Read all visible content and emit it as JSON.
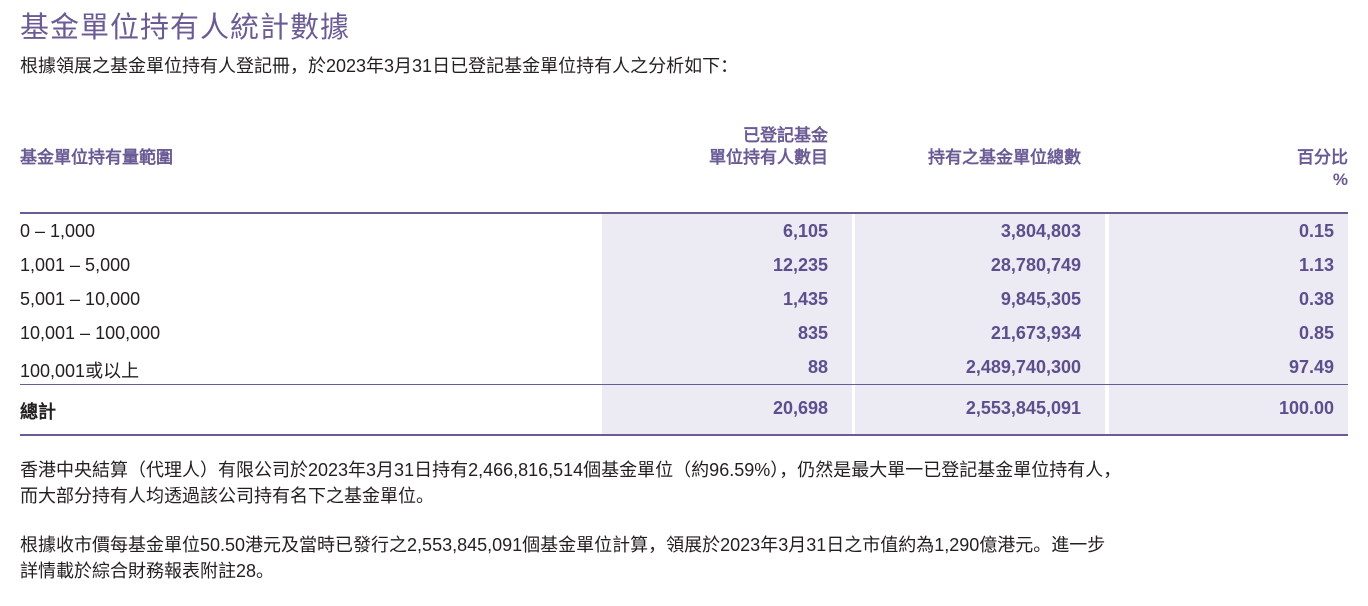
{
  "title": "基金單位持有人統計數據",
  "intro": "根據領展之基金單位持有人登記冊，於2023年3月31日已登記基金單位持有人之分析如下：",
  "table": {
    "headers": {
      "range": "基金單位持有量範圍",
      "holders_line1": "已登記基金",
      "holders_line2": "單位持有人數目",
      "units": "持有之基金單位總數",
      "percent_line1": "百分比",
      "percent_line2": "%"
    },
    "rows": [
      {
        "range": "0 – 1,000",
        "holders": "6,105",
        "units": "3,804,803",
        "percent": "0.15"
      },
      {
        "range": "1,001 – 5,000",
        "holders": "12,235",
        "units": "28,780,749",
        "percent": "1.13"
      },
      {
        "range": "5,001 – 10,000",
        "holders": "1,435",
        "units": "9,845,305",
        "percent": "0.38"
      },
      {
        "range": "10,001 – 100,000",
        "holders": "835",
        "units": "21,673,934",
        "percent": "0.85"
      },
      {
        "range": "100,001或以上",
        "holders": "88",
        "units": "2,489,740,300",
        "percent": "97.49"
      }
    ],
    "total": {
      "label": "總計",
      "holders": "20,698",
      "units": "2,553,845,091",
      "percent": "100.00"
    }
  },
  "paragraphs": {
    "p1_line1": "香港中央結算（代理人）有限公司於2023年3月31日持有2,466,816,514個基金單位（約96.59%），仍然是最大單一已登記基金單位持有人，",
    "p1_line2": "而大部分持有人均透過該公司持有名下之基金單位。",
    "p2_line1": "根據收市價每基金單位50.50港元及當時已發行之2,553,845,091個基金單位計算，領展於2023年3月31日之市值約為1,290億港元。進一步",
    "p2_line2": "詳情載於綜合財務報表附註28。"
  },
  "colors": {
    "accent": "#6b5b95",
    "number": "#5c4f8c",
    "column_bg": "#ecebf4"
  }
}
